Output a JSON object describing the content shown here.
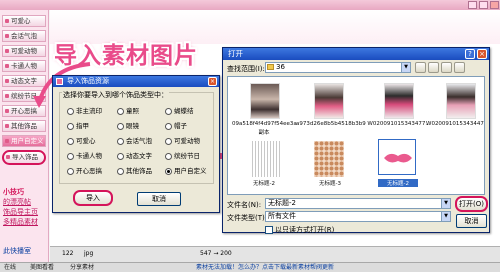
{
  "sidebar": {
    "items": [
      {
        "label": "可爱心"
      },
      {
        "label": "会话气泡"
      },
      {
        "label": "可爱动物"
      },
      {
        "label": "卡通人物"
      },
      {
        "label": "动态文字"
      },
      {
        "label": "缤纷节日"
      },
      {
        "label": "开心恶搞"
      },
      {
        "label": "其他饰品"
      },
      {
        "label": "用户自定义"
      },
      {
        "label": "导入饰品"
      }
    ],
    "links": [
      "小技巧",
      "的漂亮帖",
      "饰品导主页",
      "多精品素材"
    ],
    "footer_label": "此快播室"
  },
  "caption": "导入素材图片",
  "import_dialog": {
    "title": "导入饰品资源",
    "group_label": "选择你要导入到哪个饰品类型中：",
    "options": [
      [
        "非主流印",
        "童照",
        "蝴蝶结"
      ],
      [
        "指甲",
        "眼镜",
        "帽子"
      ],
      [
        "可爱心",
        "会话气泡",
        "可爱动物"
      ],
      [
        "卡通人物",
        "动态文字",
        "缤纷节日"
      ],
      [
        "开心恶搞",
        "其他饰品",
        "用户自定义"
      ]
    ],
    "selected_option": "用户自定义",
    "ok_label": "导入",
    "cancel_label": "取消"
  },
  "open_dialog": {
    "title": "打开",
    "help_glyph": "?",
    "close_glyph": "×",
    "look_in_label": "查找范围(I):",
    "look_in_value": "36",
    "files": [
      {
        "name": "09a518f4f4d97f54ee3a",
        "name2": "副本",
        "selected": false
      },
      {
        "name": "a973d26e8b5b4518b3b9",
        "name2": "",
        "selected": false
      },
      {
        "name": "W020091015343477...",
        "name2": "",
        "selected": false
      },
      {
        "name": "W020091015343447...",
        "name2": "",
        "selected": false
      },
      {
        "name": "无标题-2",
        "name2": "",
        "selected": false
      },
      {
        "name": "无标题-3",
        "name2": "",
        "selected": false
      },
      {
        "name": "无标题-2",
        "name2": "",
        "selected": true
      }
    ],
    "filename_label": "文件名(N):",
    "filename_value": "无标题-2",
    "filetype_label": "文件类型(T):",
    "filetype_value": "所有文件",
    "readonly_label": "以只读方式打开(R)",
    "open_label": "打开(O)",
    "cancel_label": "取消"
  },
  "ruler": {
    "left_value": "122",
    "left_unit": "jpg",
    "right_value": "547 → 200"
  },
  "statusbar": {
    "item1": "在线",
    "item2": "美图看看",
    "item3": "分享素材",
    "message": "素材无法加载！怎么办？点击下载最新素材帮阀更新"
  },
  "colors": {
    "accent": "#e94b8a",
    "highlight": "#d4145a",
    "title_bar": "#1a4cbf"
  }
}
